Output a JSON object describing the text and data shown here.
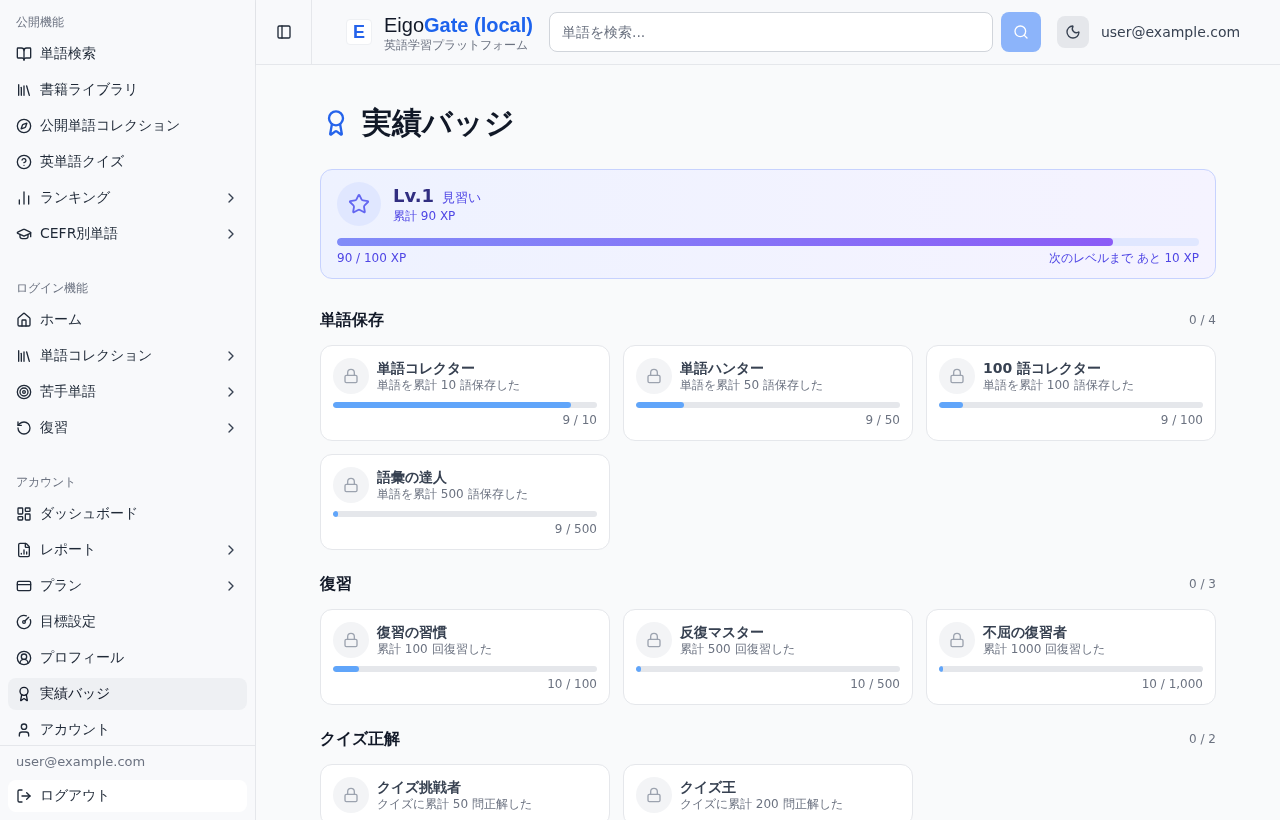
{
  "sidebar": {
    "groups": [
      {
        "label": "公開機能",
        "items": [
          {
            "label": "単語検索",
            "expandable": false,
            "selected": false
          },
          {
            "label": "書籍ライブラリ",
            "expandable": false,
            "selected": false
          },
          {
            "label": "公開単語コレクション",
            "expandable": false,
            "selected": false
          },
          {
            "label": "英単語クイズ",
            "expandable": false,
            "selected": false
          },
          {
            "label": "ランキング",
            "expandable": true,
            "selected": false
          },
          {
            "label": "CEFR別単語",
            "expandable": true,
            "selected": false
          }
        ]
      },
      {
        "label": "ログイン機能",
        "items": [
          {
            "label": "ホーム",
            "expandable": false,
            "selected": false
          },
          {
            "label": "単語コレクション",
            "expandable": true,
            "selected": false
          },
          {
            "label": "苦手単語",
            "expandable": true,
            "selected": false
          },
          {
            "label": "復習",
            "expandable": true,
            "selected": false
          }
        ]
      },
      {
        "label": "アカウント",
        "items": [
          {
            "label": "ダッシュボード",
            "expandable": false,
            "selected": false
          },
          {
            "label": "レポート",
            "expandable": true,
            "selected": false
          },
          {
            "label": "プラン",
            "expandable": true,
            "selected": false
          },
          {
            "label": "目標設定",
            "expandable": false,
            "selected": false
          },
          {
            "label": "プロフィール",
            "expandable": false,
            "selected": false
          },
          {
            "label": "実績バッジ",
            "expandable": false,
            "selected": true
          },
          {
            "label": "アカウント",
            "expandable": false,
            "selected": false
          }
        ]
      }
    ],
    "footer": {
      "email": "user@example.com",
      "logout": "ログアウト"
    }
  },
  "header": {
    "brand": {
      "logo_letter": "E",
      "name": "Eigo**Gate (local)**",
      "tagline": "英語学習プラットフォーム"
    },
    "search": {
      "placeholder": "単語を検索...",
      "button_disabled": true
    },
    "user_email": "user@example.com"
  },
  "page": {
    "title": "実績バッジ",
    "level_card": {
      "level_label": "Lv.1",
      "rank": "見習い",
      "total_xp": "累計 90 XP",
      "level": 0.9,
      "progress": "90 / 100 XP",
      "remaining": "次のレベルまで あと 10 XP"
    },
    "sections": [
      {
        "title": "単語保存",
        "count": "0 / 4",
        "badges": [
          {
            "title": "単語コレクター",
            "description": "単語を累計 10 語保存した",
            "locked": true,
            "level": 0.9,
            "progress": "9 / 10"
          },
          {
            "title": "単語ハンター",
            "description": "単語を累計 50 語保存した",
            "locked": true,
            "level": 0.18,
            "progress": "9 / 50"
          },
          {
            "title": "100 語コレクター",
            "description": "単語を累計 100 語保存した",
            "locked": true,
            "level": 0.09,
            "progress": "9 / 100"
          },
          {
            "title": "語彙の達人",
            "description": "単語を累計 500 語保存した",
            "locked": true,
            "level": 0.018,
            "progress": "9 / 500"
          }
        ]
      },
      {
        "title": "復習",
        "count": "0 / 3",
        "badges": [
          {
            "title": "復習の習慣",
            "description": "累計 100 回復習した",
            "locked": true,
            "level": 0.1,
            "progress": "10 / 100"
          },
          {
            "title": "反復マスター",
            "description": "累計 500 回復習した",
            "locked": true,
            "level": 0.02,
            "progress": "10 / 500"
          },
          {
            "title": "不屈の復習者",
            "description": "累計 1000 回復習した",
            "locked": true,
            "level": 0.01,
            "progress": "10 / 1,000"
          }
        ]
      },
      {
        "title": "クイズ正解",
        "count": "0 / 2",
        "badges": [
          {
            "title": "クイズ挑戦者",
            "description": "クイズに累計 50 問正解した",
            "locked": true
          },
          {
            "title": "クイズ王",
            "description": "クイズに累計 200 問正解した",
            "locked": true
          }
        ]
      }
    ]
  }
}
